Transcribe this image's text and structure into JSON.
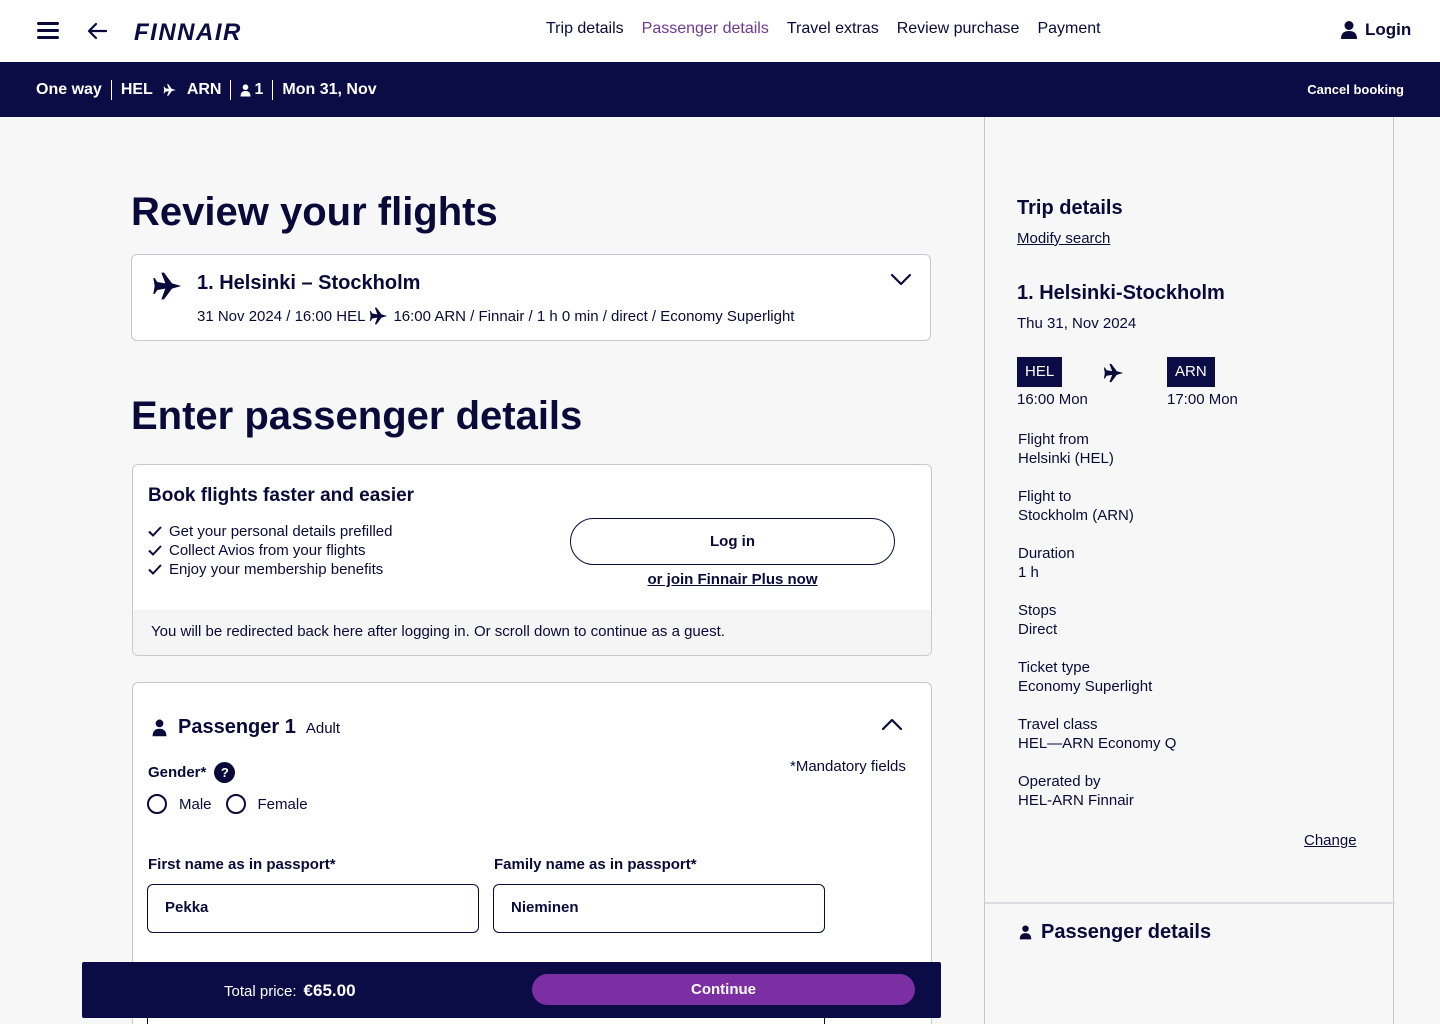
{
  "header": {
    "brand": "FINNAIR",
    "steps": [
      {
        "label": "Trip details",
        "active": false
      },
      {
        "label": "Passenger details",
        "active": true
      },
      {
        "label": "Travel extras",
        "active": false
      },
      {
        "label": "Review purchase",
        "active": false
      },
      {
        "label": "Payment",
        "active": false
      }
    ],
    "login": "Login",
    "icons": {
      "menu": "hamburger-menu-icon",
      "back": "arrow-left-icon",
      "user": "user-icon"
    }
  },
  "summary_bar": {
    "trip_type": "One way",
    "origin": "HEL",
    "destination": "ARN",
    "passengers": "1",
    "date": "Mon 31, Nov",
    "cancel": "Cancel booking"
  },
  "review": {
    "title": "Review your flights",
    "flight": {
      "title": "1. Helsinki – Stockholm",
      "detail_a": "31 Nov 2024 / 16:00 HEL",
      "detail_b": "16:00 ARN / Finnair / 1 h 0 min / direct / Economy Superlight"
    }
  },
  "passenger_section": {
    "title": "Enter passenger details",
    "login_card": {
      "title": "Book flights faster and easier",
      "benefits": [
        "Get your personal details prefilled",
        "Collect Avios from your flights",
        "Enjoy your membership benefits"
      ],
      "login_button": "Log in",
      "join_link": "or join Finnair Plus now",
      "note": "You will be redirected back here after logging in. Or scroll down to continue as a guest."
    },
    "passenger": {
      "name": "Passenger 1",
      "type": "Adult",
      "mandatory": "*Mandatory fields",
      "gender_label": "Gender*",
      "help": "?",
      "gender_options": [
        "Male",
        "Female"
      ],
      "first_name_label": "First name as in passport*",
      "first_name_value": "Pekka",
      "family_name_label": "Family name as in passport*",
      "family_name_value": "Nieminen"
    }
  },
  "sidebar": {
    "title": "Trip details",
    "modify": "Modify search",
    "route": "1. Helsinki-Stockholm",
    "date": "Thu 31, Nov 2024",
    "from_code": "HEL",
    "from_time": "16:00 Mon",
    "to_code": "ARN",
    "to_time": "17:00 Mon",
    "info": [
      {
        "label": "Flight from",
        "value": "Helsinki (HEL)"
      },
      {
        "label": "Flight to",
        "value": "Stockholm (ARN)"
      },
      {
        "label": "Duration",
        "value": "1 h"
      },
      {
        "label": "Stops",
        "value": "Direct"
      },
      {
        "label": "Ticket type",
        "value": "Economy Superlight"
      },
      {
        "label": "Travel class",
        "value": "HEL—ARN Economy Q"
      },
      {
        "label": "Operated by",
        "value": "HEL-ARN Finnair"
      }
    ],
    "change": "Change",
    "passenger_details": "Passenger details"
  },
  "bottom_bar": {
    "total_label": "Total price:",
    "total_value": "€65.00",
    "continue": "Continue"
  },
  "colors": {
    "navy": "#0b0b45",
    "text": "#0a0a3a",
    "purple": "#7b2fa3",
    "active_step": "#6e3a96"
  }
}
